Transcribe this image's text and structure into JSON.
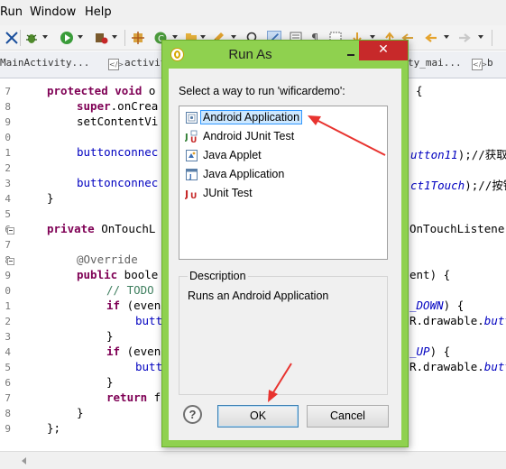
{
  "menu": [
    "Run",
    "Window",
    "Help"
  ],
  "tabs": [
    "MainActivity...",
    "activit",
    "ty_mai...",
    "b"
  ],
  "line_numbers": [
    "7",
    "8",
    "9",
    "0",
    "1",
    "2",
    "3",
    "4",
    "5",
    "6",
    "7",
    "8",
    "9",
    "0",
    "1",
    "2",
    "3",
    "4",
    "5",
    "6",
    "7",
    "8",
    "9"
  ],
  "code": {
    "l1_kw": "protected void",
    "l1_rest": " o",
    "l1_tail": "{",
    "l2_a": "super",
    "l2_b": ".onCrea",
    "l3": "setContentVi",
    "l5_a": "buttonconnec",
    "l5_tail_a": "utton11",
    "l5_tail_b": ");//获取",
    "l7_a": "buttonconnec",
    "l7_tail_a": "ct1Touch",
    "l7_tail_b": ");//按钮",
    "l8": "}",
    "l10_kw": "private",
    "l10_rest": " OnTouchL",
    "l10_tail": "OnTouchListene",
    "l12": "@Override",
    "l13_kw": "public",
    "l13_rest": " boole",
    "l13_tail": "ent) {",
    "l14": "// TODO",
    "l15_kw": "if",
    "l15_rest": " (even",
    "l15_tail_a": "_DOWN",
    "l15_tail_b": ") {",
    "l16_a": "butt",
    "l16_tail_a": "R.drawable.",
    "l16_tail_b": "butt",
    "l17": "}",
    "l18_kw": "if",
    "l18_rest": " (even",
    "l18_tail_a": "_UP",
    "l18_tail_b": ") {",
    "l19_a": "butt",
    "l19_tail_a": "R.drawable.",
    "l19_tail_b": "butt",
    "l20": "}",
    "l21_kw": "return",
    "l21_rest": " f",
    "l22": "}",
    "l23": "};"
  },
  "dialog": {
    "title": "Run As",
    "close_glyph": "✕",
    "prompt": "Select a way to run 'wificardemo':",
    "items": [
      {
        "label": "Android Application",
        "icon": "android-application-icon",
        "selected": true
      },
      {
        "label": "Android JUnit Test",
        "icon": "junit-test-icon",
        "selected": false
      },
      {
        "label": "Java Applet",
        "icon": "java-applet-icon",
        "selected": false
      },
      {
        "label": "Java Application",
        "icon": "java-application-icon",
        "selected": false
      },
      {
        "label": "JUnit Test",
        "icon": "junit-icon",
        "selected": false
      }
    ],
    "description_label": "Description",
    "description_text": "Runs an Android Application",
    "help_glyph": "?",
    "ok_label": "OK",
    "cancel_label": "Cancel"
  },
  "colors": {
    "dialog_frame": "#8fd14f",
    "close_button": "#c7292a",
    "selection_fill": "#cde8ff",
    "annotation_arrow": "#e8332f"
  }
}
